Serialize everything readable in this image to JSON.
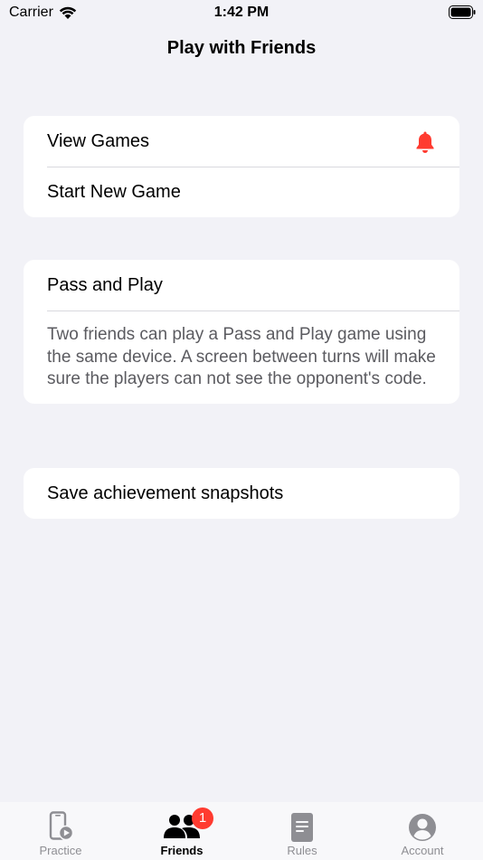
{
  "status_bar": {
    "carrier": "Carrier",
    "time": "1:42 PM"
  },
  "nav": {
    "title": "Play with Friends"
  },
  "games_card": {
    "view_games": "View Games",
    "start_new_game": "Start New Game"
  },
  "pass_play_card": {
    "title": "Pass and Play",
    "description": "Two friends can play a Pass and Play game using the same device. A screen between turns will make sure the players can not see the opponent's code."
  },
  "snapshots_card": {
    "label": "Save achievement snapshots"
  },
  "tab_bar": {
    "tabs": [
      {
        "label": "Practice"
      },
      {
        "label": "Friends",
        "badge": "1"
      },
      {
        "label": "Rules"
      },
      {
        "label": "Account"
      }
    ]
  },
  "colors": {
    "accent": "#ff3b30",
    "background": "#f2f2f7",
    "inactive": "#8e8e93"
  }
}
